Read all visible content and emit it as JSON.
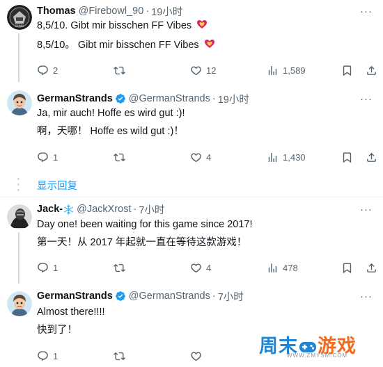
{
  "tweets": [
    {
      "name": "Thomas",
      "handle": "@Firebowl_90",
      "time": "19小时",
      "text": "8,5/10. Gibt mir bisschen FF Vibes",
      "translation": "8,5/10。 Gibt mir bisschen FF Vibes",
      "emoji": "sparkling-heart",
      "verified": false,
      "replies": "2",
      "likes": "12",
      "views": "1,589"
    },
    {
      "name": "GermanStrands",
      "handle": "@GermanStrands",
      "time": "19小时",
      "text": "Ja, mir auch! Hoffe es wird gut :)!",
      "translation": "啊，天哪！ Hoffe es wild gut :)！",
      "verified": true,
      "replies": "1",
      "likes": "4",
      "views": "1,430"
    },
    {
      "name": "Jack-",
      "name_emoji": "snowflake",
      "handle": "@JackXrost",
      "time": "7小时",
      "text": "Day one! been waiting for this game since 2017!",
      "translation": "第一天！从 2017 年起就一直在等待这款游戏！",
      "verified": false,
      "replies": "1",
      "likes": "4",
      "views": "478"
    },
    {
      "name": "GermanStrands",
      "handle": "@GermanStrands",
      "time": "7小时",
      "text": "Almost there!!!!",
      "translation": "快到了！",
      "verified": true,
      "replies": "1",
      "likes": "",
      "views": ""
    }
  ],
  "show_replies": "显示回复",
  "dot": "·",
  "more": "···",
  "watermark": {
    "main_blue": "周末",
    "main_orange": "游戏",
    "sub": "WWW.ZMYSM.COM"
  },
  "colors": {
    "accent": "#1d9bf0",
    "muted": "#536471",
    "verified": "#1d9bf0",
    "heart": "#e0245e"
  }
}
